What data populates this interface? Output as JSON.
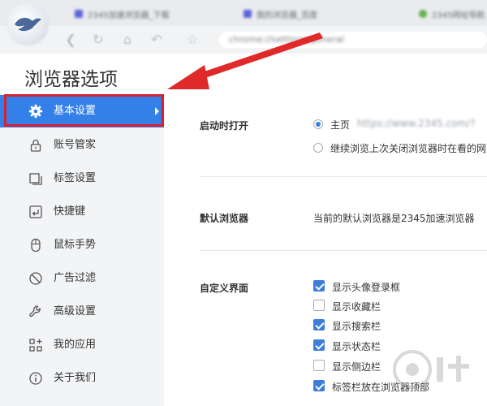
{
  "chrome": {
    "tabs": [
      {
        "title": "2345加速浏览器_下载"
      },
      {
        "title": "我的浏览器_百度"
      },
      {
        "title": "2345网址导航"
      }
    ],
    "url": "chrome://settings/general"
  },
  "page": {
    "title": "浏览器选项"
  },
  "sidebar": {
    "items": [
      {
        "label": "基本设置",
        "icon": "gear-icon"
      },
      {
        "label": "账号管家",
        "icon": "lock-icon"
      },
      {
        "label": "标签设置",
        "icon": "tabs-icon"
      },
      {
        "label": "快捷键",
        "icon": "keyboard-shortcut-icon"
      },
      {
        "label": "鼠标手势",
        "icon": "mouse-icon"
      },
      {
        "label": "广告过滤",
        "icon": "block-icon"
      },
      {
        "label": "高级设置",
        "icon": "wrench-icon"
      },
      {
        "label": "我的应用",
        "icon": "apps-grid-icon"
      },
      {
        "label": "关于我们",
        "icon": "info-icon"
      }
    ],
    "active_index": 0
  },
  "main": {
    "startup": {
      "label": "启动时打开",
      "options": [
        {
          "label": "主页",
          "detail": "https://www.2345.com/?",
          "selected": true
        },
        {
          "label": "继续浏览上次关闭浏览器时在看的网页",
          "selected": false
        }
      ]
    },
    "default_browser": {
      "label": "默认浏览器",
      "text": "当前的默认浏览器是2345加速浏览器"
    },
    "custom_ui": {
      "label": "自定义界面",
      "options": [
        {
          "label": "显示头像登录框",
          "checked": true
        },
        {
          "label": "显示收藏栏",
          "checked": false
        },
        {
          "label": "显示搜索栏",
          "checked": true
        },
        {
          "label": "显示状态栏",
          "checked": true
        },
        {
          "label": "显示侧边栏",
          "checked": false
        },
        {
          "label": "标签栏放在浏览器顶部",
          "checked": true
        }
      ]
    }
  },
  "colors": {
    "accent": "#3381e8",
    "highlight": "#d7212f",
    "checkbox": "#3c7ed8"
  }
}
